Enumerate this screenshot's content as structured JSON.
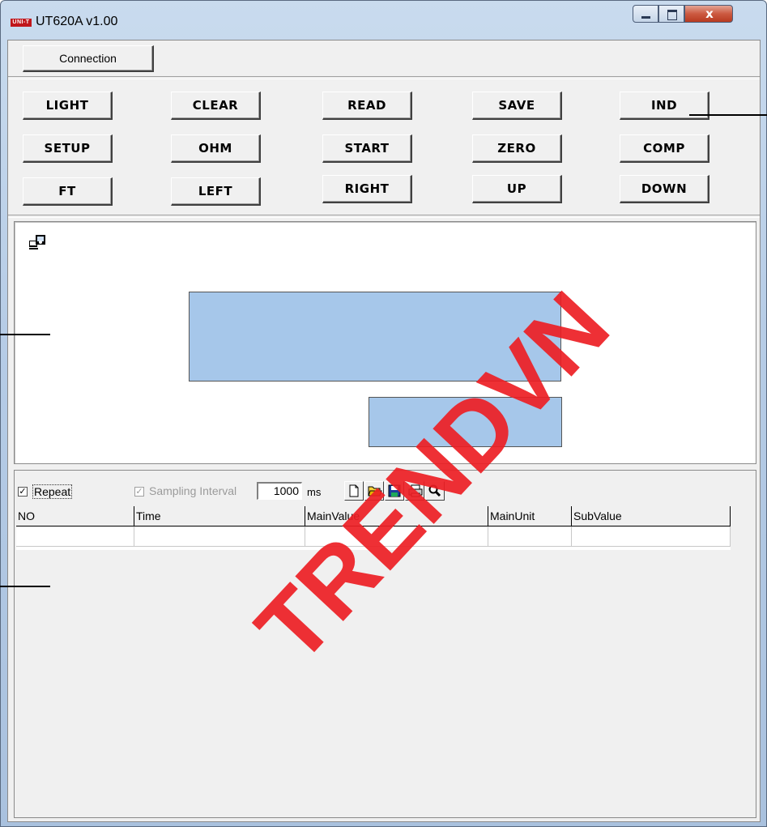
{
  "window": {
    "title": "UT620A v1.00",
    "logo_text": "UNI-T",
    "close_glyph": "x"
  },
  "toolbar": {
    "connection_label": "Connection"
  },
  "keys": {
    "row1": [
      "LIGHT",
      "CLEAR",
      "READ",
      "SAVE",
      "IND"
    ],
    "row2": [
      "SETUP",
      "OHM",
      "START",
      "ZERO",
      "COMP"
    ],
    "row3": [
      "FT",
      "LEFT",
      "RIGHT",
      "UP",
      "DOWN"
    ]
  },
  "display": {
    "main_color": "#a6c7ea",
    "sub_color": "#a6c7ea",
    "status_icon": "computer-connection-icon"
  },
  "logging": {
    "repeat_label": "Repeat",
    "repeat_checked": true,
    "sampling_label": "Sampling Interval",
    "sampling_checked": true,
    "sampling_enabled": false,
    "interval_value": "1000",
    "interval_unit": "ms",
    "tools": [
      "new-file-icon",
      "open-folder-icon",
      "save-disk-icon",
      "print-icon",
      "zoom-icon"
    ]
  },
  "table": {
    "columns": [
      "NO",
      "Time",
      "MainValue",
      "MainUnit",
      "SubValue"
    ],
    "rows": [
      [
        "",
        "",
        "",
        "",
        ""
      ]
    ]
  },
  "watermark": {
    "text": "TRENDVN"
  }
}
